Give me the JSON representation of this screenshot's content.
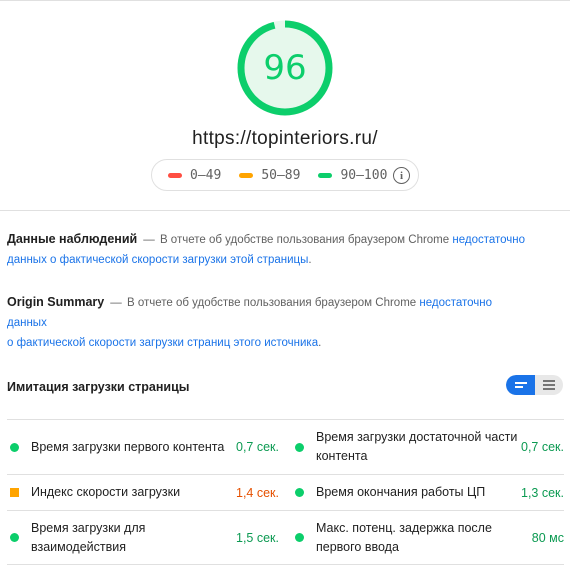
{
  "report": {
    "score": "96",
    "url": "https://topinteriors.ru/"
  },
  "colors": {
    "pass": "#0cce6b",
    "average": "#ffa400",
    "fail": "#ff4e42",
    "link": "#1a73e8"
  },
  "legend": [
    {
      "range": "0–49",
      "color": "#ff4e42"
    },
    {
      "range": "50–89",
      "color": "#ffa400"
    },
    {
      "range": "90–100",
      "color": "#0cce6b"
    }
  ],
  "field_data": {
    "title": "Данные наблюдений",
    "dash": "—",
    "text": "В отчете об удобстве пользования браузером Chrome",
    "link_line1": "недостаточно",
    "link_line2": "данных о фактической скорости загрузки этой страницы",
    "tail": "."
  },
  "origin_summary": {
    "title": "Origin Summary",
    "dash": "—",
    "text": "В отчете об удобстве пользования браузером Chrome",
    "link_line1": "недостаточно данных",
    "link_line2": "о фактической скорости загрузки страниц этого источника",
    "tail": "."
  },
  "lab_data": {
    "title": "Имитация загрузки страницы",
    "toggle_icons": [
      "compact-view-icon",
      "list-view-icon"
    ]
  },
  "metrics": [
    {
      "label": "Время загрузки первого контента",
      "value": "0,7 сек.",
      "status": "pass"
    },
    {
      "label": "Время загрузки достаточной части контента",
      "value": "0,7 сек.",
      "status": "pass"
    },
    {
      "label": "Индекс скорости загрузки",
      "value": "1,4 сек.",
      "status": "average"
    },
    {
      "label": "Время окончания работы ЦП",
      "value": "1,3 сек.",
      "status": "pass"
    },
    {
      "label": "Время загрузки для взаимодействия",
      "value": "1,5 сек.",
      "status": "pass"
    },
    {
      "label": "Макс. потенц. задержка после первого ввода",
      "value": "80 мс",
      "status": "pass"
    }
  ]
}
